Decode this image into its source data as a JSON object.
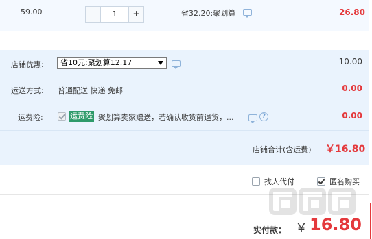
{
  "item": {
    "price": "59.00",
    "quantity": "1",
    "minus_label": "-",
    "plus_label": "+",
    "save_note": "省32.20:聚划算",
    "subtotal": "26.80"
  },
  "store_promo": {
    "label": "店铺优惠:",
    "selected": "省10元:聚划算12.17",
    "value": "-10.00"
  },
  "shipping": {
    "label": "运送方式:",
    "text": "普通配送 快递 免邮",
    "value": "0.00"
  },
  "insurance": {
    "label": "运费险:",
    "tag": "运费险",
    "text": "聚划算卖家赠送，若确认收货前退货，...",
    "help": "?",
    "value": "0.00"
  },
  "store_total": {
    "label": "店铺合计(含运费)",
    "value": "￥16.80"
  },
  "options": {
    "pay_for_me": "找人代付",
    "anonymous": "匿名购买"
  },
  "payment": {
    "label": "实付款：",
    "currency": "￥",
    "amount": "16.80"
  },
  "colors": {
    "accent_red": "#e4393c",
    "panel_blue": "#eaf3fd",
    "insurance_tag": "#2e9a6a"
  },
  "icons": [
    "chat-icon",
    "help-icon",
    "checkbox-icon",
    "watermark-logo"
  ]
}
